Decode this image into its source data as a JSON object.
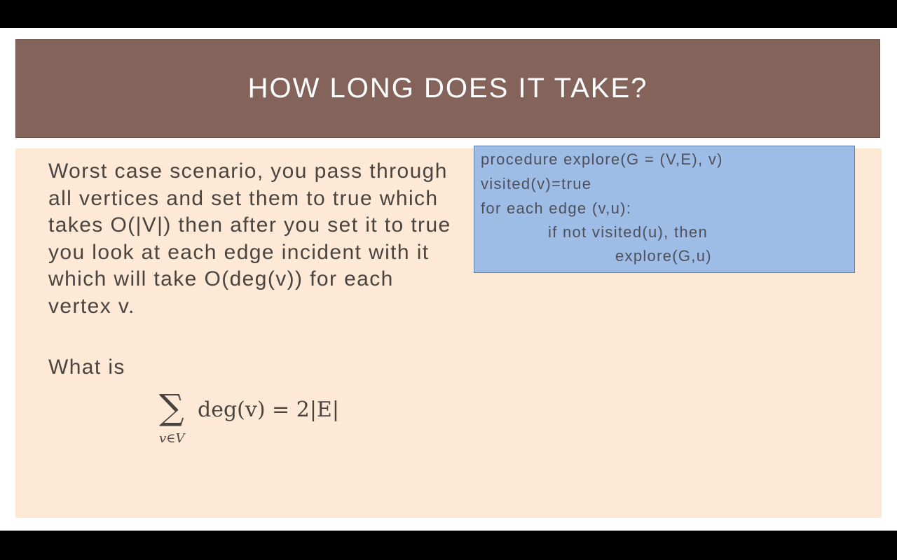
{
  "slide": {
    "title": "HOW LONG DOES IT TAKE?",
    "body_text": "Worst case scenario, you pass through all vertices and set them to true which takes O(|V|) then after you set it to true you look at each edge incident with it which will take O(deg(v)) for each vertex v.",
    "what_is": "What is",
    "formula": {
      "sum_symbol": "∑",
      "subscript": "v∈V",
      "expression": "deg(v) = 2|E|"
    },
    "code": {
      "lines": [
        "procedure explore(G = (V,E), v)",
        "visited(v)=true",
        "for each edge (v,u):",
        "if not visited(u), then",
        "explore(G,u)"
      ]
    }
  },
  "colors": {
    "title_bar": "#84635a",
    "content_panel": "#fde9d5",
    "code_box": "#9dbde6",
    "text": "#4a4441"
  }
}
